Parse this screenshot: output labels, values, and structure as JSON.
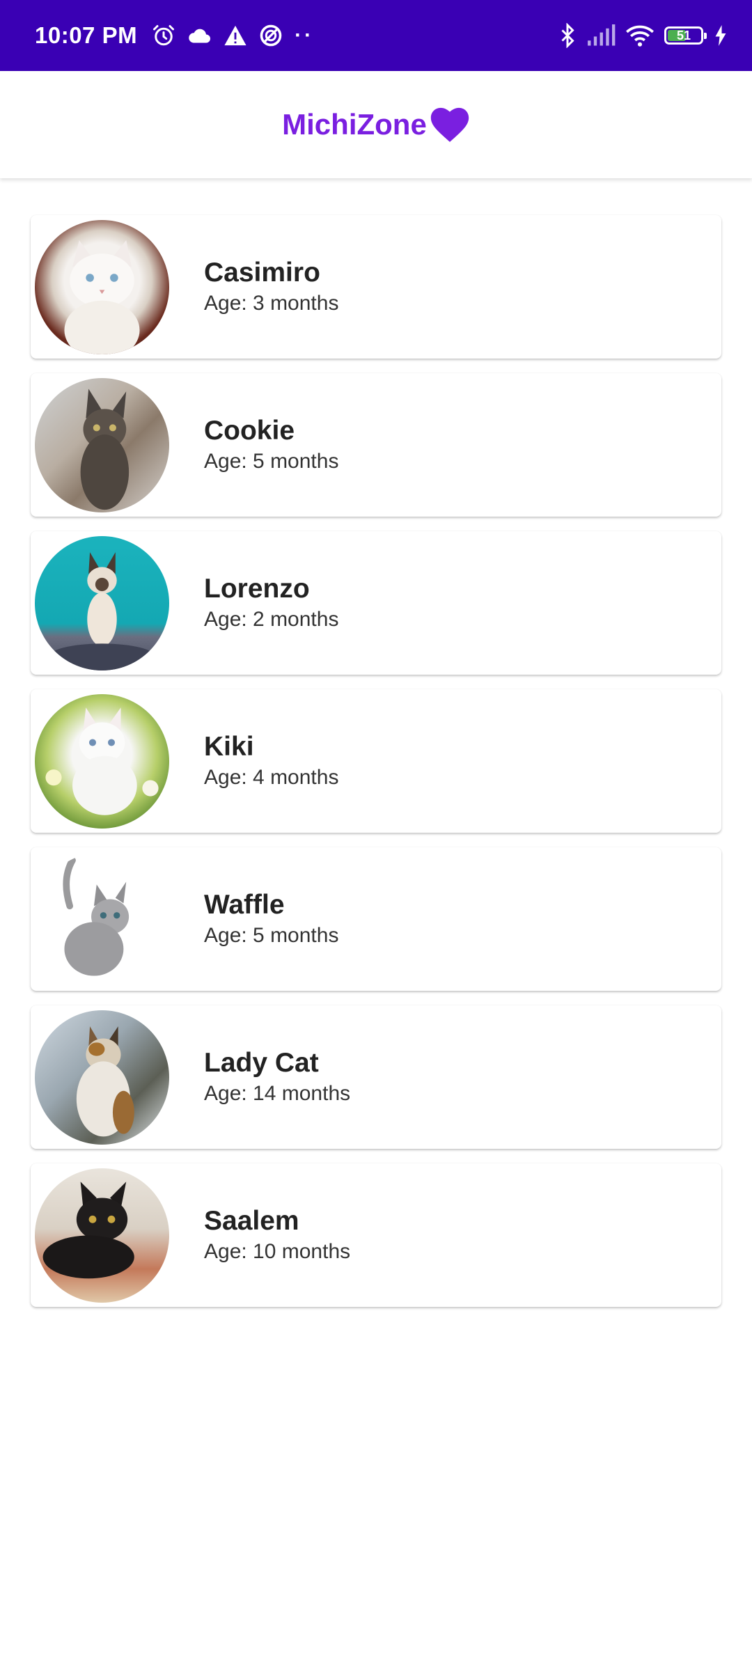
{
  "status_bar": {
    "time": "10:07 PM",
    "battery": "51",
    "icons": [
      "alarm-icon",
      "cloud-icon",
      "warning-icon",
      "data-saver-icon",
      "more-dots-icon",
      "bluetooth-icon",
      "signal-icon",
      "wifi-icon",
      "battery-icon",
      "charging-icon"
    ]
  },
  "app_bar": {
    "title": "MichiZone",
    "title_color": "#7a1fe0"
  },
  "cats": [
    {
      "name": "Casimiro",
      "age": "Age: 3 months"
    },
    {
      "name": "Cookie",
      "age": "Age: 5 months"
    },
    {
      "name": "Lorenzo",
      "age": "Age: 2 months"
    },
    {
      "name": "Kiki",
      "age": "Age: 4 months"
    },
    {
      "name": "Waffle",
      "age": "Age: 5 months"
    },
    {
      "name": "Lady Cat",
      "age": "Age: 14 months"
    },
    {
      "name": "Saalem",
      "age": "Age: 10 months"
    }
  ],
  "colors": {
    "status_bar": "#3a00b4",
    "accent": "#7a1fe0"
  }
}
